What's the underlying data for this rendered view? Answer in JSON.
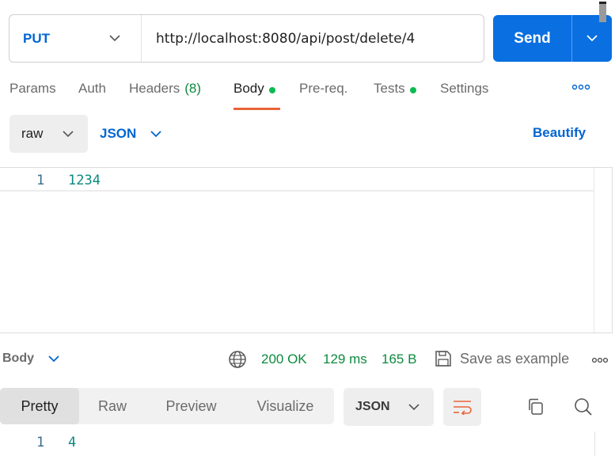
{
  "request": {
    "method": "PUT",
    "url": "http://localhost:8080/api/post/delete/4",
    "send_label": "Send"
  },
  "tabs": {
    "params": "Params",
    "auth": "Auth",
    "headers": "Headers",
    "headers_count": "(8)",
    "body": "Body",
    "prereq": "Pre-req.",
    "tests": "Tests",
    "settings": "Settings",
    "active": "Body"
  },
  "body_options": {
    "mode": "raw",
    "language": "JSON",
    "beautify": "Beautify"
  },
  "editor": {
    "line_number": "1",
    "content": "1234"
  },
  "response": {
    "label": "Body",
    "status": "200 OK",
    "time": "129 ms",
    "size": "165 B",
    "save_example": "Save as example",
    "tabs": [
      "Pretty",
      "Raw",
      "Preview",
      "Visualize"
    ],
    "active_tab": "Pretty",
    "format": "JSON",
    "line_number": "1",
    "content": "4"
  },
  "colors": {
    "accent_blue": "#0a6fe0",
    "tab_underline": "#e8643a",
    "status_green": "#0c8a3e",
    "dot_green": "#0cbb52"
  },
  "icons": [
    "chevron-down-icon",
    "more-icon",
    "globe-icon",
    "save-icon",
    "wrap-lines-icon",
    "copy-icon",
    "search-icon"
  ]
}
